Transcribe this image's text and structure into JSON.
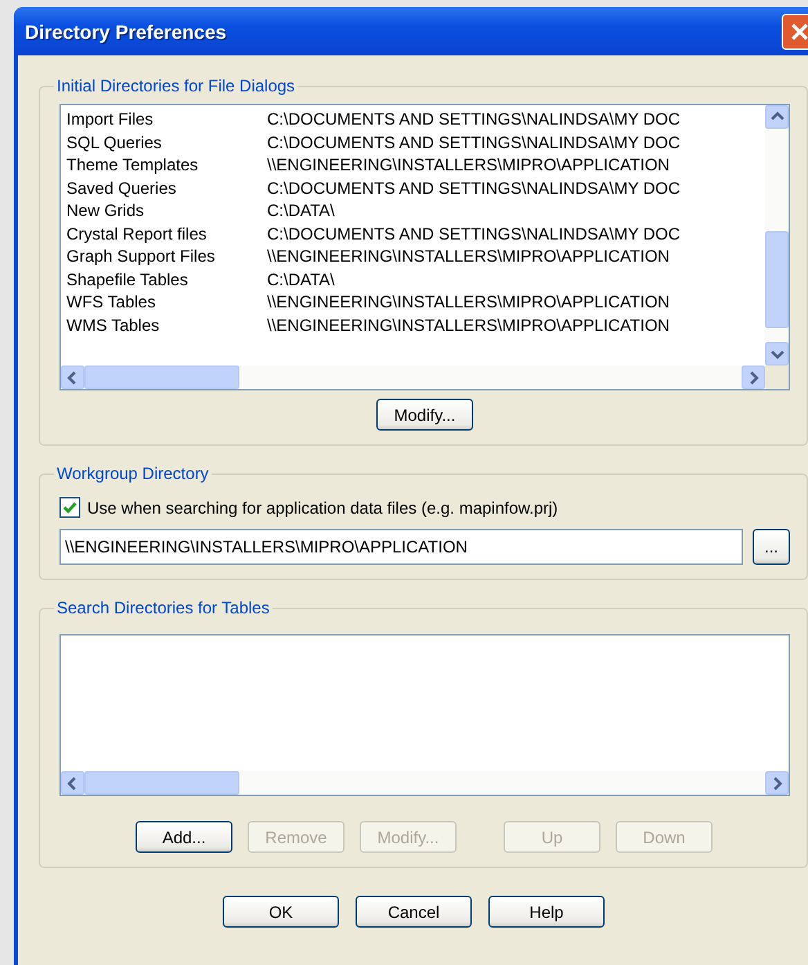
{
  "window": {
    "title": "Directory Preferences"
  },
  "initial_directories": {
    "label": "Initial Directories for File Dialogs",
    "rows": [
      {
        "name": "Import Files",
        "path": "C:\\DOCUMENTS AND SETTINGS\\NALINDSA\\MY DOC"
      },
      {
        "name": "SQL Queries",
        "path": "C:\\DOCUMENTS AND SETTINGS\\NALINDSA\\MY DOC"
      },
      {
        "name": "Theme Templates",
        "path": "\\\\ENGINEERING\\INSTALLERS\\MIPRO\\APPLICATION"
      },
      {
        "name": "Saved Queries",
        "path": "C:\\DOCUMENTS AND SETTINGS\\NALINDSA\\MY DOC"
      },
      {
        "name": "New Grids",
        "path": "C:\\DATA\\"
      },
      {
        "name": "Crystal Report files",
        "path": "C:\\DOCUMENTS AND SETTINGS\\NALINDSA\\MY DOC"
      },
      {
        "name": "Graph Support Files",
        "path": "\\\\ENGINEERING\\INSTALLERS\\MIPRO\\APPLICATION"
      },
      {
        "name": "Shapefile Tables",
        "path": "C:\\DATA\\"
      },
      {
        "name": "WFS Tables",
        "path": "\\\\ENGINEERING\\INSTALLERS\\MIPRO\\APPLICATION"
      },
      {
        "name": "WMS Tables",
        "path": "\\\\ENGINEERING\\INSTALLERS\\MIPRO\\APPLICATION"
      }
    ],
    "button": {
      "label": "Modify...",
      "disabled": false
    }
  },
  "workgroup_directory": {
    "label": "Workgroup Directory",
    "checkbox": {
      "label": "Use when searching for application data files (e.g. mapinfow.prj)",
      "checked": true
    },
    "value": "\\\\ENGINEERING\\INSTALLERS\\MIPRO\\APPLICATION",
    "browse_button": "..."
  },
  "search_directories": {
    "label": "Search Directories for Tables",
    "buttons": [
      {
        "label": "Add...",
        "disabled": false
      },
      {
        "label": "Remove",
        "disabled": true
      },
      {
        "label": "Modify...",
        "disabled": true
      },
      {
        "label": "Up",
        "disabled": true
      },
      {
        "label": "Down",
        "disabled": true
      }
    ]
  },
  "buttons": [
    "OK",
    "Cancel",
    "Help"
  ]
}
